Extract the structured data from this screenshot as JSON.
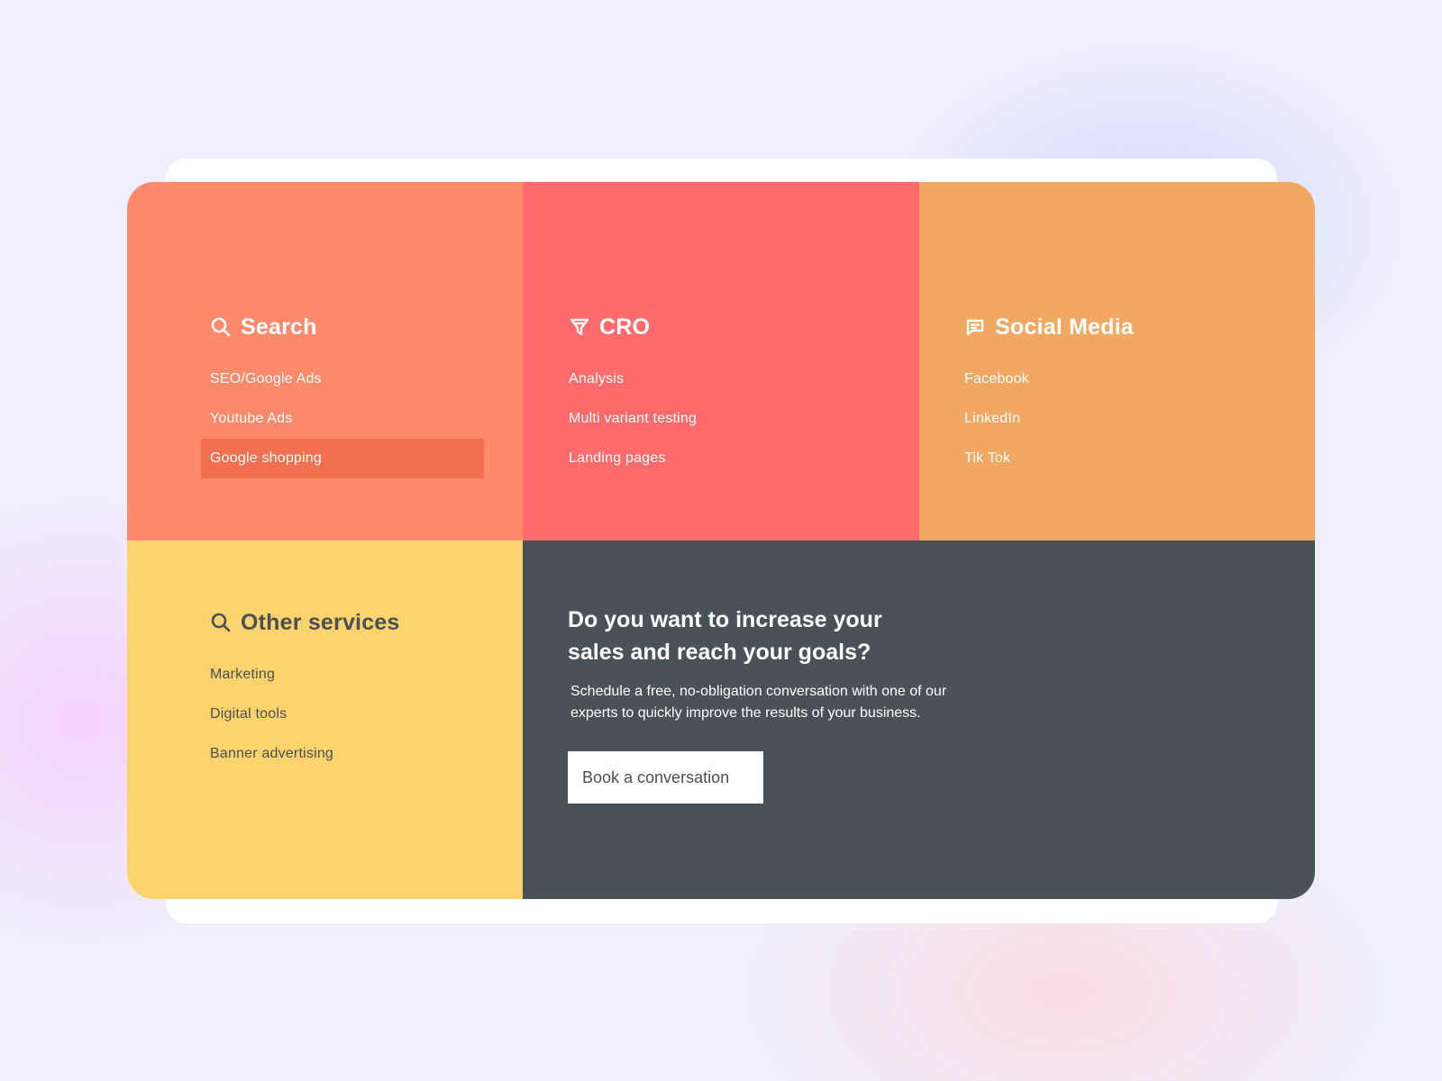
{
  "menu": {
    "search": {
      "title": "Search",
      "icon": "search-icon",
      "items": [
        {
          "label": "SEO/Google Ads"
        },
        {
          "label": "Youtube Ads"
        },
        {
          "label": "Google shopping",
          "active": true
        }
      ]
    },
    "cro": {
      "title": "CRO",
      "icon": "filter-icon",
      "items": [
        {
          "label": "Analysis"
        },
        {
          "label": "Multi variant testing"
        },
        {
          "label": "Landing pages"
        }
      ]
    },
    "social": {
      "title": "Social Media",
      "icon": "chat-icon",
      "items": [
        {
          "label": "Facebook"
        },
        {
          "label": "LinkedIn"
        },
        {
          "label": "Tik Tok"
        }
      ]
    },
    "other": {
      "title": "Other services",
      "icon": "search-icon",
      "items": [
        {
          "label": "Marketing"
        },
        {
          "label": "Digital tools"
        },
        {
          "label": "Banner advertising"
        }
      ]
    }
  },
  "cta": {
    "heading": "Do you want to increase your sales and reach your goals?",
    "text": "Schedule a free, no-obligation conversation with one of our experts to quickly improve the results of your business.",
    "button_label": "Book a conversation"
  },
  "colors": {
    "search_panel": "#fd8a6c",
    "cro_panel": "#fd6b6c",
    "social_panel": "#f0a862",
    "other_panel": "#fcd36c",
    "cta_panel": "#495357",
    "active_item": "#f3704f"
  }
}
